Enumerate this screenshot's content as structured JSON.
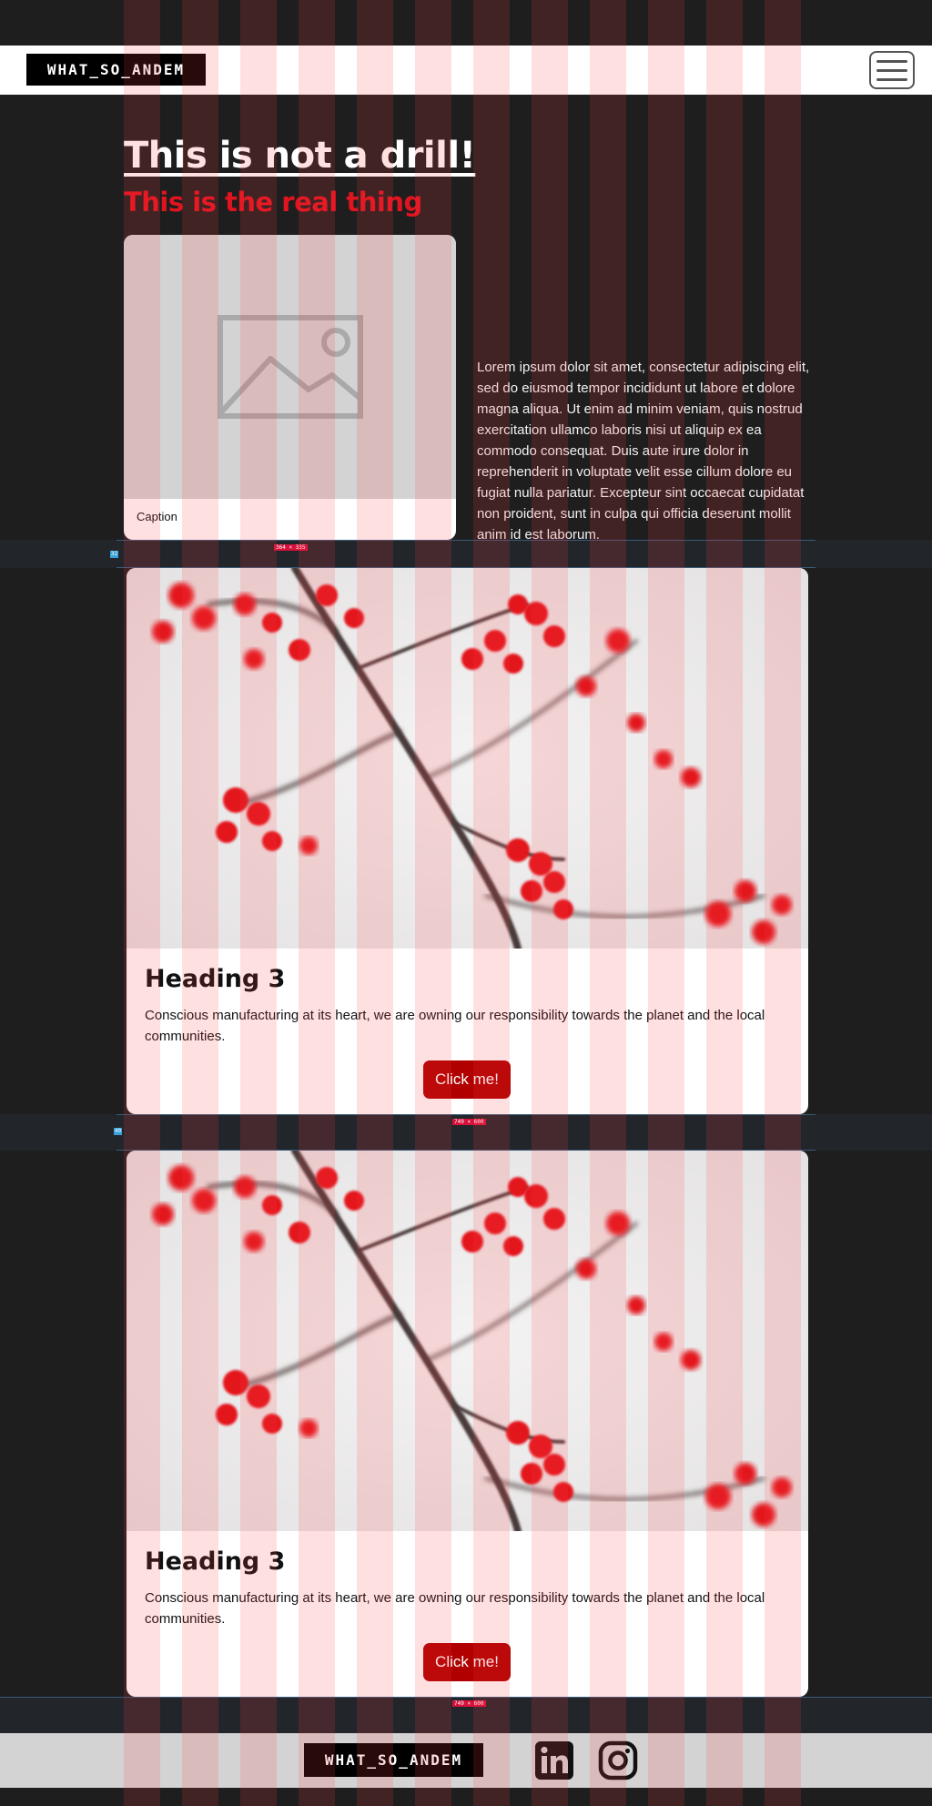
{
  "header": {
    "logo_text": "WHAT_SO_ANDEM",
    "menu_icon": "hamburger-icon"
  },
  "hero": {
    "title": "This is not a drill!",
    "subtitle": "This is the real thing",
    "figure": {
      "image_icon": "image-placeholder-icon",
      "caption": "Caption"
    },
    "paragraph": "Lorem ipsum dolor sit amet, consectetur adipiscing elit, sed do eiusmod tempor incididunt ut labore et dolore magna aliqua. Ut enim ad minim veniam, quis nostrud exercitation ullamco laboris nisi ut aliquip ex ea commodo consequat. Duis aute irure dolor in reprehenderit in voluptate velit esse cillum dolore eu fugiat nulla pariatur. Excepteur sint occaecat cupidatat non proident, sunt in culpa qui officia deserunt mollit anim id est laborum."
  },
  "dev_overlay": {
    "figure_size_tag": "364 × 335",
    "card_size_tag": "749 × 600",
    "gap_tag_1": "32",
    "gap_tag_2": "40"
  },
  "cards": [
    {
      "heading": "Heading 3",
      "text": "Conscious manufacturing at its heart, we are owning our responsibility towards the planet and the local communities.",
      "button": "Click me!"
    },
    {
      "heading": "Heading 3",
      "text": "Conscious manufacturing at its heart, we are owning our responsibility towards the planet and the local communities.",
      "button": "Click me!"
    }
  ],
  "footer": {
    "logo_text": "WHAT_SO_ANDEM",
    "social": [
      "linkedin-icon",
      "instagram-icon"
    ]
  },
  "colors": {
    "page_bg": "#1e1e1e",
    "accent_red": "#e0141e",
    "button_red": "#b00000",
    "berry_red": "#e3121c",
    "footer_bg": "#d3d3d3"
  }
}
